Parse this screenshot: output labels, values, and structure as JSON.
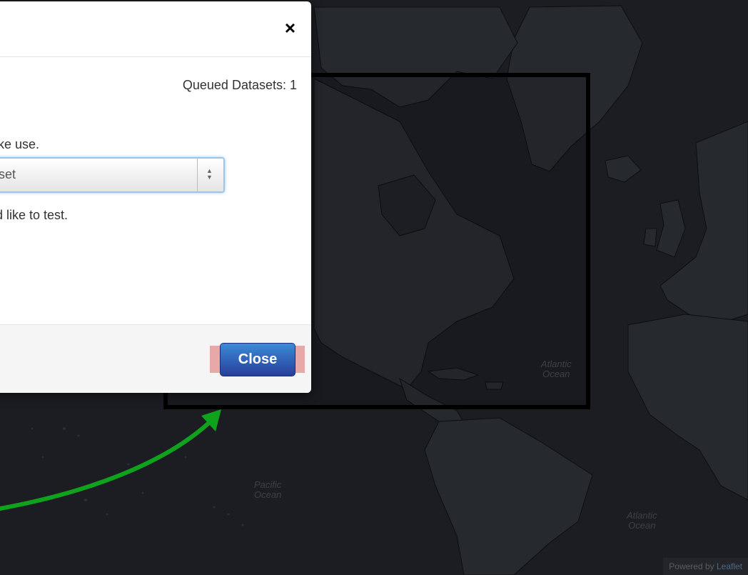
{
  "map": {
    "labels": {
      "atlantic_north_1": "Atlantic",
      "atlantic_north_2": "Ocean",
      "pacific_1": "Pacific",
      "pacific_2": "Ocean",
      "atlantic_south_1": "Atlantic",
      "atlantic_south_2": "Ocean"
    },
    "attribution": {
      "prefix": "Powered by ",
      "link": "Leaflet"
    },
    "colors": {
      "ocean": "#1b1d22",
      "land": "#26292e",
      "borders": "#000000",
      "selection_box": "#000000",
      "arrow": "#0fa21d"
    }
  },
  "modal": {
    "close_icon": "×",
    "queued_label": "Queued Datasets: 1",
    "instruction_dataset": "l like use.",
    "select": {
      "value": "aset",
      "arrow_icon": "up-down-chevron-icon"
    },
    "instruction_test": "uld like to test.",
    "footer": {
      "close_button": "Close"
    }
  }
}
